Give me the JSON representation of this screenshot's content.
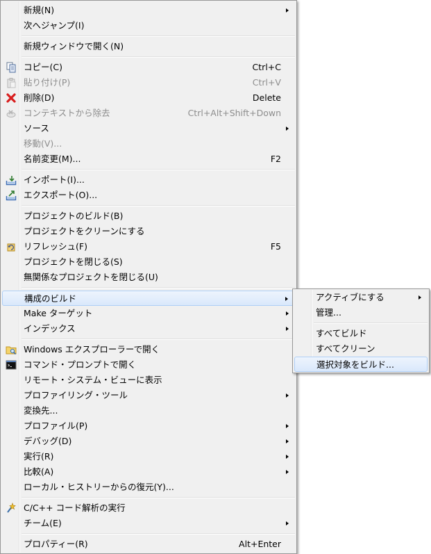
{
  "main_menu": {
    "items": [
      {
        "label": "新規(N)",
        "submenu": true
      },
      {
        "label": "次へジャンプ(I)"
      },
      {
        "label": "新規ウィンドウで開く(N)"
      },
      {
        "label": "コピー(C)",
        "accel": "Ctrl+C",
        "icon": "copy-icon"
      },
      {
        "label": "貼り付け(P)",
        "accel": "Ctrl+V",
        "icon": "paste-icon",
        "disabled": true
      },
      {
        "label": "削除(D)",
        "accel": "Delete",
        "icon": "delete-icon"
      },
      {
        "label": "コンテキストから除去",
        "accel": "Ctrl+Alt+Shift+Down",
        "icon": "remove-from-context-icon",
        "disabled": true
      },
      {
        "label": "ソース",
        "submenu": true
      },
      {
        "label": "移動(V)...",
        "disabled": true
      },
      {
        "label": "名前変更(M)...",
        "accel": "F2"
      },
      {
        "label": "インポート(I)...",
        "icon": "import-icon"
      },
      {
        "label": "エクスポート(O)...",
        "icon": "export-icon"
      },
      {
        "label": "プロジェクトのビルド(B)"
      },
      {
        "label": "プロジェクトをクリーンにする"
      },
      {
        "label": "リフレッシュ(F)",
        "accel": "F5",
        "icon": "refresh-icon"
      },
      {
        "label": "プロジェクトを閉じる(S)"
      },
      {
        "label": "無関係なプロジェクトを閉じる(U)"
      },
      {
        "label": "構成のビルド",
        "submenu": true,
        "selected": true
      },
      {
        "label": "Make ターゲット",
        "submenu": true
      },
      {
        "label": "インデックス",
        "submenu": true
      },
      {
        "label": "Windows エクスプローラーで開く",
        "icon": "explorer-folder-icon"
      },
      {
        "label": "コマンド・プロンプトで開く",
        "icon": "command-prompt-icon"
      },
      {
        "label": "リモート・システム・ビューに表示"
      },
      {
        "label": "プロファイリング・ツール",
        "submenu": true
      },
      {
        "label": "変換先..."
      },
      {
        "label": "プロファイル(P)",
        "submenu": true
      },
      {
        "label": "デバッグ(D)",
        "submenu": true
      },
      {
        "label": "実行(R)",
        "submenu": true
      },
      {
        "label": "比較(A)",
        "submenu": true
      },
      {
        "label": "ローカル・ヒストリーからの復元(Y)..."
      },
      {
        "label": "C/C++ コード解析の実行",
        "icon": "code-analysis-icon"
      },
      {
        "label": "チーム(E)",
        "submenu": true
      },
      {
        "label": "プロパティー(R)",
        "accel": "Alt+Enter"
      }
    ]
  },
  "build_config_submenu": {
    "items": [
      {
        "label": "アクティブにする",
        "submenu": true
      },
      {
        "label": "管理..."
      },
      {
        "label": "すべてビルド"
      },
      {
        "label": "すべてクリーン"
      },
      {
        "label": "選択対象をビルド...",
        "selected": true
      }
    ]
  }
}
